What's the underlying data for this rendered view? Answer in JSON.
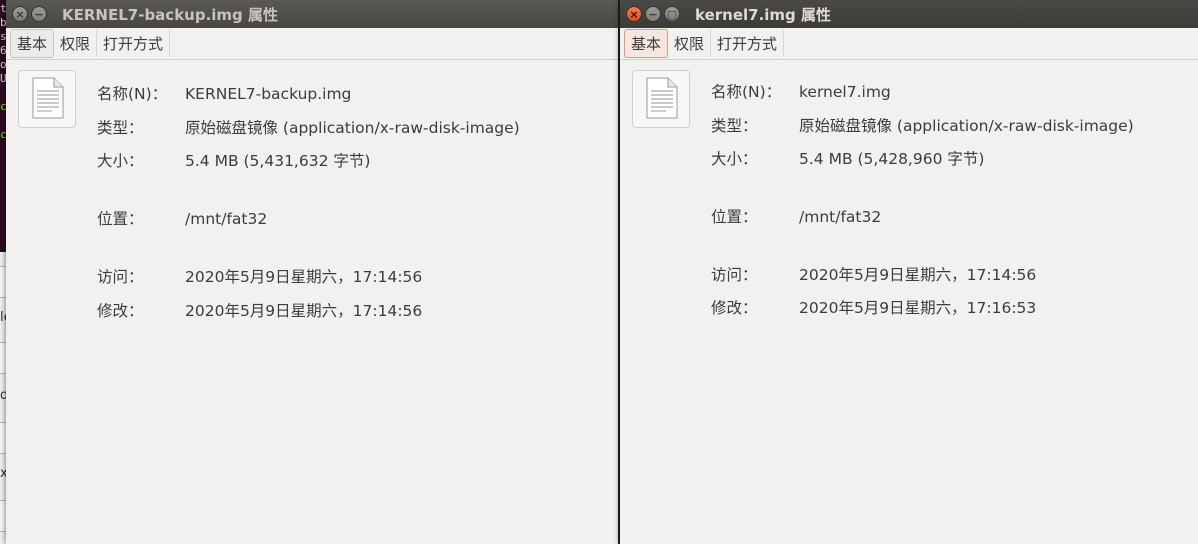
{
  "background": {
    "terminal_chars": [
      "t",
      "b",
      "s",
      "6",
      "o",
      "U",
      "",
      "c",
      "",
      "c"
    ],
    "side_letters": [
      "le",
      "d",
      "x."
    ]
  },
  "windows": [
    {
      "title": "KERNEL7-backup.img 属性",
      "tabs": [
        "基本",
        "权限",
        "打开方式"
      ],
      "active_tab": "基本",
      "labels": {
        "name": "名称(N)：",
        "type": "类型：",
        "size": "大小：",
        "location": "位置：",
        "accessed": "访问：",
        "modified": "修改："
      },
      "values": {
        "name": "KERNEL7-backup.img",
        "type": "原始磁盘镜像 (application/x-raw-disk-image)",
        "size": "5.4 MB (5,431,632 字节)",
        "location": "/mnt/fat32",
        "accessed": "2020年5月9日星期六，17:14:56",
        "modified": "2020年5月9日星期六，17:14:56"
      },
      "icon": "text-file-icon"
    },
    {
      "title": "kernel7.img 属性",
      "tabs": [
        "基本",
        "权限",
        "打开方式"
      ],
      "active_tab": "基本",
      "labels": {
        "name": "名称(N)：",
        "type": "类型：",
        "size": "大小：",
        "location": "位置：",
        "accessed": "访问：",
        "modified": "修改："
      },
      "values": {
        "name": "kernel7.img",
        "type": "原始磁盘镜像 (application/x-raw-disk-image)",
        "size": "5.4 MB (5,428,960 字节)",
        "location": "/mnt/fat32",
        "accessed": "2020年5月9日星期六，17:14:56",
        "modified": "2020年5月9日星期六，17:16:53"
      },
      "icon": "text-file-icon"
    }
  ],
  "window_buttons": {
    "close": "×",
    "minimize": "−",
    "maximize": "□"
  },
  "colors": {
    "titlebar": "#3c3b37",
    "close_button": "#df4a16",
    "window_bg": "#f2f1f0",
    "active_tab_border": "#e09a80"
  }
}
